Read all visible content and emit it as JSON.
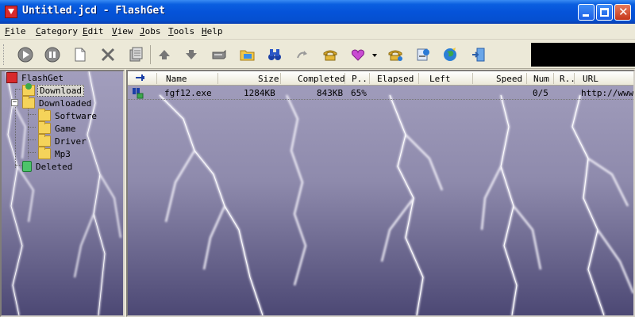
{
  "window": {
    "title": "Untitled.jcd - FlashGet"
  },
  "menu": [
    "File",
    "Category",
    "Edit",
    "View",
    "Jobs",
    "Tools",
    "Help"
  ],
  "toolbar": {
    "buttons": [
      "start-job",
      "pause-job",
      "new-job",
      "delete-job",
      "properties",
      "move-up",
      "move-down",
      "open-batch",
      "open-folder",
      "find",
      "redial",
      "dialup",
      "schedule",
      "scheduler-dropdown",
      "connect",
      "site-manager",
      "globe",
      "exit"
    ]
  },
  "tree": {
    "root": "FlashGet",
    "download": "Download",
    "downloaded": "Downloaded",
    "software": "Software",
    "game": "Game",
    "driver": "Driver",
    "mp3": "Mp3",
    "deleted": "Deleted"
  },
  "table": {
    "columns": [
      "Name",
      "Size",
      "Completed",
      "P..",
      "Elapsed",
      "Left",
      "Speed",
      "Num",
      "R..",
      "URL"
    ],
    "rows": [
      {
        "name": "fgf12.exe",
        "size": "1284KB",
        "completed": "843KB",
        "percent": "65%",
        "elapsed": "",
        "left": "",
        "speed": "",
        "num": "0/5",
        "r": "",
        "url": "http://www."
      }
    ]
  },
  "colors": {
    "title_bar": "#0553d9",
    "chrome": "#ece9d8",
    "background_sky": "#6e6a94"
  }
}
